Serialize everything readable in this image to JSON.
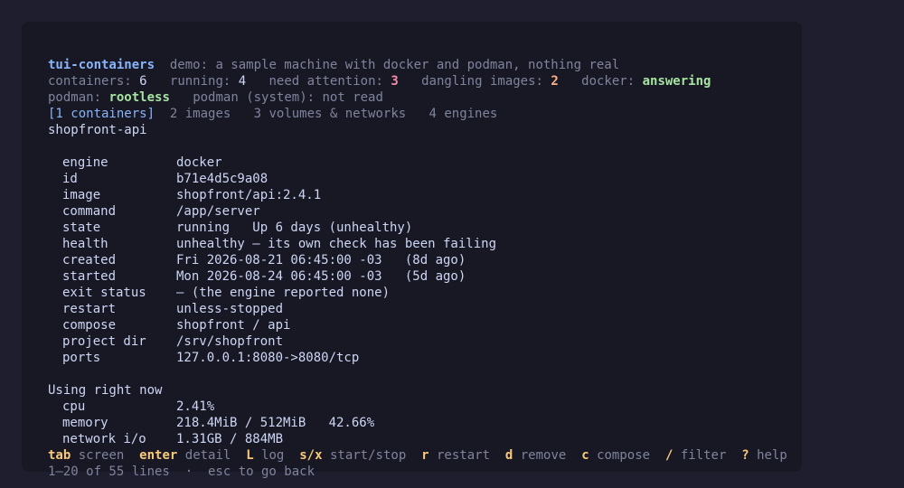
{
  "header": {
    "app_name": "tui-containers",
    "subtitle": "demo: a sample machine with docker and podman, nothing real"
  },
  "stats": {
    "containers_label": "containers:",
    "containers_value": "6",
    "running_label": "running:",
    "running_value": "4",
    "attention_label": "need attention:",
    "attention_value": "3",
    "dangling_label": "dangling images:",
    "dangling_value": "2",
    "docker_label": "docker:",
    "docker_value": "answering"
  },
  "engines_status": {
    "podman_label": "podman:",
    "podman_value": "rootless",
    "podman_system": "podman (system): not read"
  },
  "tabs": [
    {
      "label": "[1 containers]",
      "active": true
    },
    {
      "label": "2 images",
      "active": false
    },
    {
      "label": "3 volumes & networks",
      "active": false
    },
    {
      "label": "4 engines",
      "active": false
    }
  ],
  "container_name": "shopfront-api",
  "details": [
    {
      "key": "engine",
      "value": "docker"
    },
    {
      "key": "id",
      "value": "b71e4d5c9a08"
    },
    {
      "key": "image",
      "value": "shopfront/api:2.4.1"
    },
    {
      "key": "command",
      "value": "/app/server"
    },
    {
      "key": "state",
      "value": "running   Up 6 days (unhealthy)"
    },
    {
      "key": "health",
      "value": "unhealthy — its own check has been failing"
    },
    {
      "key": "created",
      "value": "Fri 2026-08-21 06:45:00 -03   (8d ago)"
    },
    {
      "key": "started",
      "value": "Mon 2026-08-24 06:45:00 -03   (5d ago)"
    },
    {
      "key": "exit status",
      "value": "— (the engine reported none)"
    },
    {
      "key": "restart",
      "value": "unless-stopped"
    },
    {
      "key": "compose",
      "value": "shopfront / api"
    },
    {
      "key": "project dir",
      "value": "/srv/shopfront"
    },
    {
      "key": "ports",
      "value": "127.0.0.1:8080->8080/tcp"
    }
  ],
  "usage": {
    "heading": "Using right now",
    "rows": [
      {
        "key": "cpu",
        "value": "2.41%"
      },
      {
        "key": "memory",
        "value": "218.4MiB / 512MiB   42.66%"
      },
      {
        "key": "network i/o",
        "value": "1.31GB / 884MB"
      }
    ]
  },
  "keybar": [
    {
      "key": "tab",
      "action": "screen"
    },
    {
      "key": "enter",
      "action": "detail"
    },
    {
      "key": "L",
      "action": "log"
    },
    {
      "key": "s/x",
      "action": "start/stop"
    },
    {
      "key": "r",
      "action": "restart"
    },
    {
      "key": "d",
      "action": "remove"
    },
    {
      "key": "c",
      "action": "compose"
    },
    {
      "key": "/",
      "action": "filter"
    },
    {
      "key": "?",
      "action": "help"
    }
  ],
  "status_line": "1–20 of 55 lines  ·  esc to go back",
  "colors": {
    "background": "#1e1e2e",
    "panel": "#181825",
    "accent_blue": "#89b4fa",
    "ok_green": "#a6e3a1",
    "warn_peach": "#fab387",
    "alert_red": "#f38ba8",
    "key_yellow": "#f9c97a"
  }
}
